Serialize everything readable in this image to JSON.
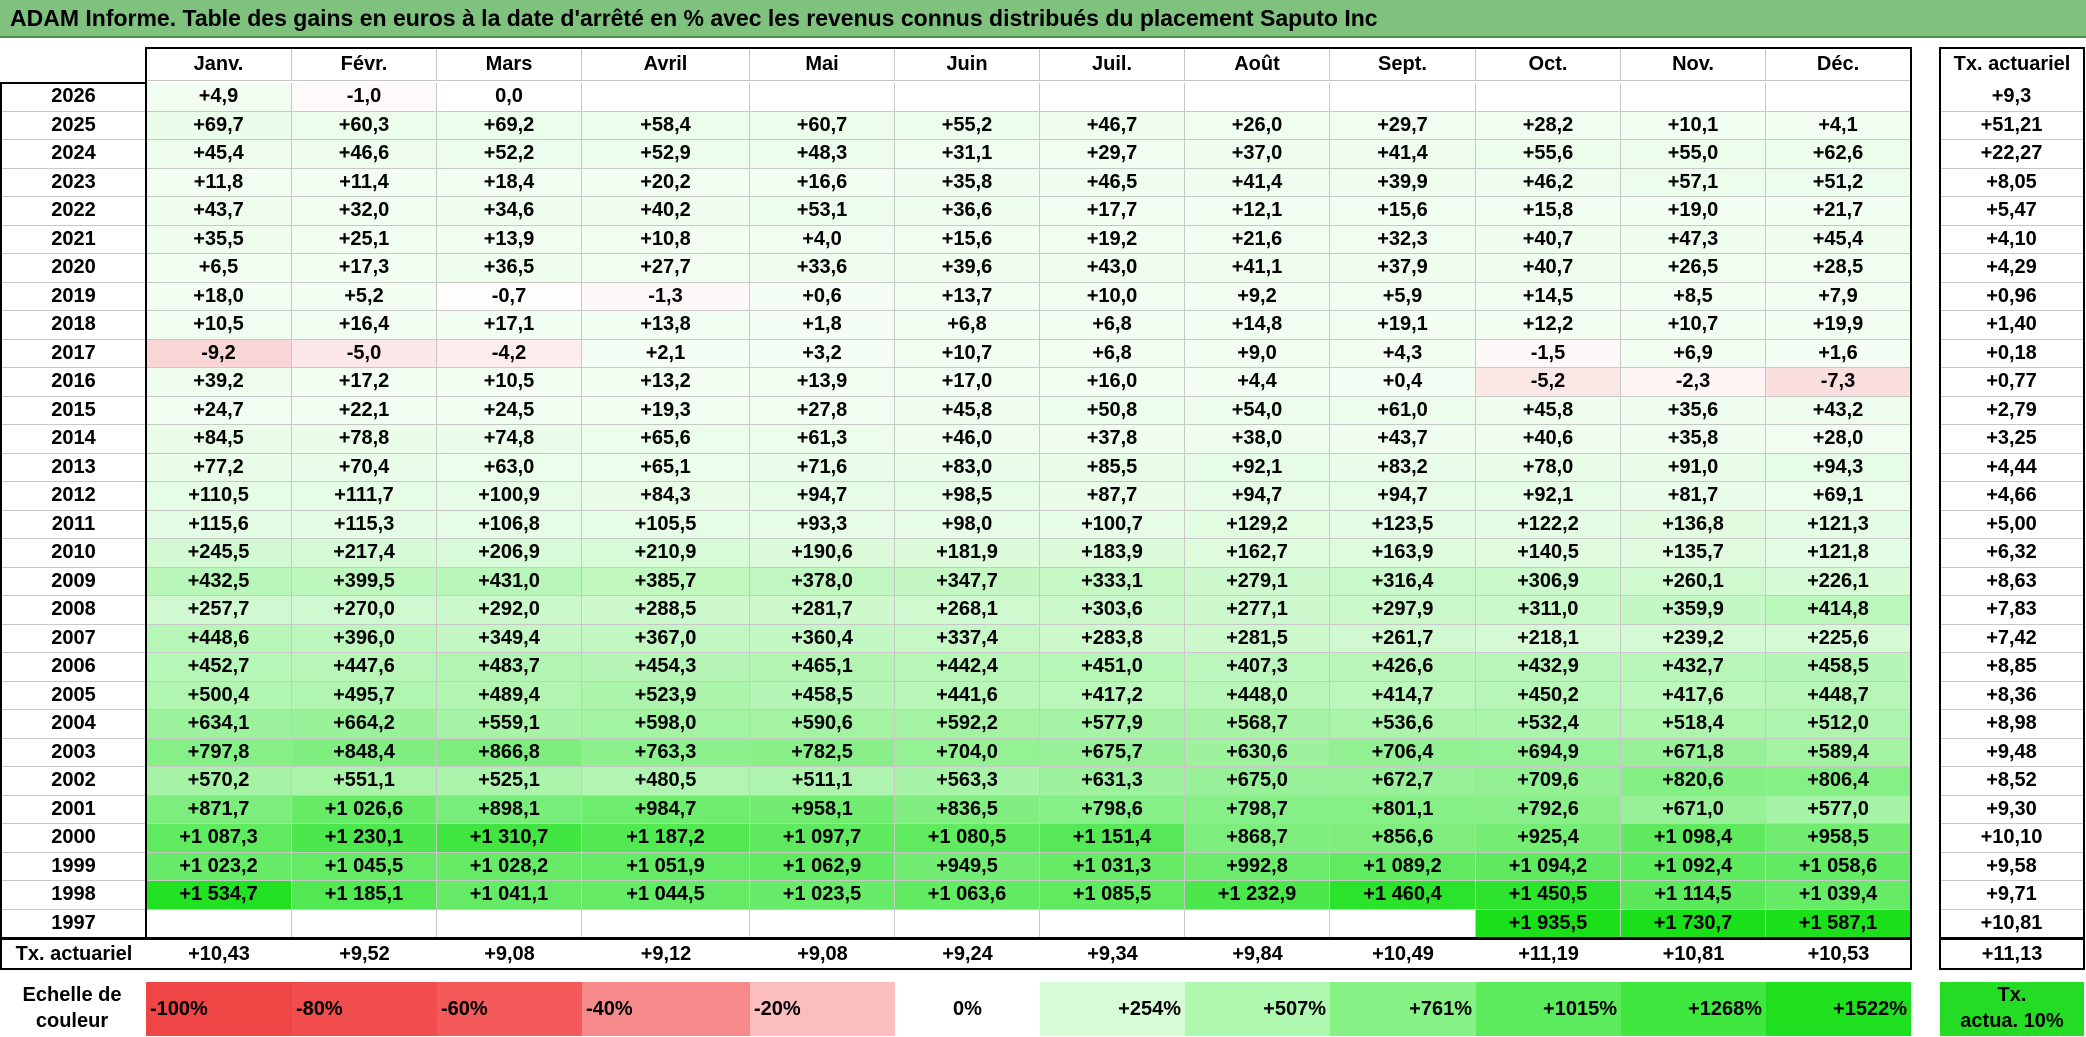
{
  "title": "ADAM Informe. Table des gains en euros à la date d'arrêté en % avec les revenus connus distribués du placement Saputo Inc",
  "chart_data": {
    "type": "table",
    "months": [
      "Janv.",
      "Févr.",
      "Mars",
      "Avril",
      "Mai",
      "Juin",
      "Juil.",
      "Août",
      "Sept.",
      "Oct.",
      "Nov.",
      "Déc."
    ],
    "rate_header": "Tx. actuariel",
    "rows": [
      {
        "year": "2026",
        "values": [
          "+4,9",
          "-1,0",
          "0,0",
          "",
          "",
          "",
          "",
          "",
          "",
          "",
          "",
          ""
        ],
        "rate": "+9,3"
      },
      {
        "year": "2025",
        "values": [
          "+69,7",
          "+60,3",
          "+69,2",
          "+58,4",
          "+60,7",
          "+55,2",
          "+46,7",
          "+26,0",
          "+29,7",
          "+28,2",
          "+10,1",
          "+4,1"
        ],
        "rate": "+51,21"
      },
      {
        "year": "2024",
        "values": [
          "+45,4",
          "+46,6",
          "+52,2",
          "+52,9",
          "+48,3",
          "+31,1",
          "+29,7",
          "+37,0",
          "+41,4",
          "+55,6",
          "+55,0",
          "+62,6"
        ],
        "rate": "+22,27"
      },
      {
        "year": "2023",
        "values": [
          "+11,8",
          "+11,4",
          "+18,4",
          "+20,2",
          "+16,6",
          "+35,8",
          "+46,5",
          "+41,4",
          "+39,9",
          "+46,2",
          "+57,1",
          "+51,2"
        ],
        "rate": "+8,05"
      },
      {
        "year": "2022",
        "values": [
          "+43,7",
          "+32,0",
          "+34,6",
          "+40,2",
          "+53,1",
          "+36,6",
          "+17,7",
          "+12,1",
          "+15,6",
          "+15,8",
          "+19,0",
          "+21,7"
        ],
        "rate": "+5,47"
      },
      {
        "year": "2021",
        "values": [
          "+35,5",
          "+25,1",
          "+13,9",
          "+10,8",
          "+4,0",
          "+15,6",
          "+19,2",
          "+21,6",
          "+32,3",
          "+40,7",
          "+47,3",
          "+45,4"
        ],
        "rate": "+4,10"
      },
      {
        "year": "2020",
        "values": [
          "+6,5",
          "+17,3",
          "+36,5",
          "+27,7",
          "+33,6",
          "+39,6",
          "+43,0",
          "+41,1",
          "+37,9",
          "+40,7",
          "+26,5",
          "+28,5"
        ],
        "rate": "+4,29"
      },
      {
        "year": "2019",
        "values": [
          "+18,0",
          "+5,2",
          "-0,7",
          "-1,3",
          "+0,6",
          "+13,7",
          "+10,0",
          "+9,2",
          "+5,9",
          "+14,5",
          "+8,5",
          "+7,9"
        ],
        "rate": "+0,96"
      },
      {
        "year": "2018",
        "values": [
          "+10,5",
          "+16,4",
          "+17,1",
          "+13,8",
          "+1,8",
          "+6,8",
          "+6,8",
          "+14,8",
          "+19,1",
          "+12,2",
          "+10,7",
          "+19,9"
        ],
        "rate": "+1,40"
      },
      {
        "year": "2017",
        "values": [
          "-9,2",
          "-5,0",
          "-4,2",
          "+2,1",
          "+3,2",
          "+10,7",
          "+6,8",
          "+9,0",
          "+4,3",
          "-1,5",
          "+6,9",
          "+1,6"
        ],
        "rate": "+0,18"
      },
      {
        "year": "2016",
        "values": [
          "+39,2",
          "+17,2",
          "+10,5",
          "+13,2",
          "+13,9",
          "+17,0",
          "+16,0",
          "+4,4",
          "+0,4",
          "-5,2",
          "-2,3",
          "-7,3"
        ],
        "rate": "+0,77"
      },
      {
        "year": "2015",
        "values": [
          "+24,7",
          "+22,1",
          "+24,5",
          "+19,3",
          "+27,8",
          "+45,8",
          "+50,8",
          "+54,0",
          "+61,0",
          "+45,8",
          "+35,6",
          "+43,2"
        ],
        "rate": "+2,79"
      },
      {
        "year": "2014",
        "values": [
          "+84,5",
          "+78,8",
          "+74,8",
          "+65,6",
          "+61,3",
          "+46,0",
          "+37,8",
          "+38,0",
          "+43,7",
          "+40,6",
          "+35,8",
          "+28,0"
        ],
        "rate": "+3,25"
      },
      {
        "year": "2013",
        "values": [
          "+77,2",
          "+70,4",
          "+63,0",
          "+65,1",
          "+71,6",
          "+83,0",
          "+85,5",
          "+92,1",
          "+83,2",
          "+78,0",
          "+91,0",
          "+94,3"
        ],
        "rate": "+4,44"
      },
      {
        "year": "2012",
        "values": [
          "+110,5",
          "+111,7",
          "+100,9",
          "+84,3",
          "+94,7",
          "+98,5",
          "+87,7",
          "+94,7",
          "+94,7",
          "+92,1",
          "+81,7",
          "+69,1"
        ],
        "rate": "+4,66"
      },
      {
        "year": "2011",
        "values": [
          "+115,6",
          "+115,3",
          "+106,8",
          "+105,5",
          "+93,3",
          "+98,0",
          "+100,7",
          "+129,2",
          "+123,5",
          "+122,2",
          "+136,8",
          "+121,3"
        ],
        "rate": "+5,00"
      },
      {
        "year": "2010",
        "values": [
          "+245,5",
          "+217,4",
          "+206,9",
          "+210,9",
          "+190,6",
          "+181,9",
          "+183,9",
          "+162,7",
          "+163,9",
          "+140,5",
          "+135,7",
          "+121,8"
        ],
        "rate": "+6,32"
      },
      {
        "year": "2009",
        "values": [
          "+432,5",
          "+399,5",
          "+431,0",
          "+385,7",
          "+378,0",
          "+347,7",
          "+333,1",
          "+279,1",
          "+316,4",
          "+306,9",
          "+260,1",
          "+226,1"
        ],
        "rate": "+8,63"
      },
      {
        "year": "2008",
        "values": [
          "+257,7",
          "+270,0",
          "+292,0",
          "+288,5",
          "+281,7",
          "+268,1",
          "+303,6",
          "+277,1",
          "+297,9",
          "+311,0",
          "+359,9",
          "+414,8"
        ],
        "rate": "+7,83"
      },
      {
        "year": "2007",
        "values": [
          "+448,6",
          "+396,0",
          "+349,4",
          "+367,0",
          "+360,4",
          "+337,4",
          "+283,8",
          "+281,5",
          "+261,7",
          "+218,1",
          "+239,2",
          "+225,6"
        ],
        "rate": "+7,42"
      },
      {
        "year": "2006",
        "values": [
          "+452,7",
          "+447,6",
          "+483,7",
          "+454,3",
          "+465,1",
          "+442,4",
          "+451,0",
          "+407,3",
          "+426,6",
          "+432,9",
          "+432,7",
          "+458,5"
        ],
        "rate": "+8,85"
      },
      {
        "year": "2005",
        "values": [
          "+500,4",
          "+495,7",
          "+489,4",
          "+523,9",
          "+458,5",
          "+441,6",
          "+417,2",
          "+448,0",
          "+414,7",
          "+450,2",
          "+417,6",
          "+448,7"
        ],
        "rate": "+8,36"
      },
      {
        "year": "2004",
        "values": [
          "+634,1",
          "+664,2",
          "+559,1",
          "+598,0",
          "+590,6",
          "+592,2",
          "+577,9",
          "+568,7",
          "+536,6",
          "+532,4",
          "+518,4",
          "+512,0"
        ],
        "rate": "+8,98"
      },
      {
        "year": "2003",
        "values": [
          "+797,8",
          "+848,4",
          "+866,8",
          "+763,3",
          "+782,5",
          "+704,0",
          "+675,7",
          "+630,6",
          "+706,4",
          "+694,9",
          "+671,8",
          "+589,4"
        ],
        "rate": "+9,48"
      },
      {
        "year": "2002",
        "values": [
          "+570,2",
          "+551,1",
          "+525,1",
          "+480,5",
          "+511,1",
          "+563,3",
          "+631,3",
          "+675,0",
          "+672,7",
          "+709,6",
          "+820,6",
          "+806,4"
        ],
        "rate": "+8,52"
      },
      {
        "year": "2001",
        "values": [
          "+871,7",
          "+1 026,6",
          "+898,1",
          "+984,7",
          "+958,1",
          "+836,5",
          "+798,6",
          "+798,7",
          "+801,1",
          "+792,6",
          "+671,0",
          "+577,0"
        ],
        "rate": "+9,30"
      },
      {
        "year": "2000",
        "values": [
          "+1 087,3",
          "+1 230,1",
          "+1 310,7",
          "+1 187,2",
          "+1 097,7",
          "+1 080,5",
          "+1 151,4",
          "+868,7",
          "+856,6",
          "+925,4",
          "+1 098,4",
          "+958,5"
        ],
        "rate": "+10,10"
      },
      {
        "year": "1999",
        "values": [
          "+1 023,2",
          "+1 045,5",
          "+1 028,2",
          "+1 051,9",
          "+1 062,9",
          "+949,5",
          "+1 031,3",
          "+992,8",
          "+1 089,2",
          "+1 094,2",
          "+1 092,4",
          "+1 058,6"
        ],
        "rate": "+9,58"
      },
      {
        "year": "1998",
        "values": [
          "+1 534,7",
          "+1 185,1",
          "+1 041,1",
          "+1 044,5",
          "+1 023,5",
          "+1 063,6",
          "+1 085,5",
          "+1 232,9",
          "+1 460,4",
          "+1 450,5",
          "+1 114,5",
          "+1 039,4"
        ],
        "rate": "+9,71"
      },
      {
        "year": "1997",
        "values": [
          "",
          "",
          "",
          "",
          "",
          "",
          "",
          "",
          "",
          "+1 935,5",
          "+1 730,7",
          "+1 587,1"
        ],
        "rate": "+10,81"
      }
    ],
    "footer": {
      "label": "Tx. actuariel",
      "values": [
        "+10,43",
        "+9,52",
        "+9,08",
        "+9,12",
        "+9,08",
        "+9,24",
        "+9,34",
        "+9,84",
        "+10,49",
        "+11,19",
        "+10,81",
        "+10,53"
      ],
      "rate": "+11,13"
    },
    "legend": {
      "label_line1": "Echelle de",
      "label_line2": "couleur",
      "items": [
        {
          "label": "-100%",
          "color": "#f04545",
          "value": -100
        },
        {
          "label": "-80%",
          "color": "#f24d4d",
          "value": -80
        },
        {
          "label": "-60%",
          "color": "#f45a5a",
          "value": -60
        },
        {
          "label": "-40%",
          "color": "#f68a8a",
          "value": -40
        },
        {
          "label": "-20%",
          "color": "#fbbdbd",
          "value": -20
        },
        {
          "label": "0%",
          "color": "#ffffff",
          "value": 0
        },
        {
          "label": "+254%",
          "color": "#d6fbd6",
          "value": 254
        },
        {
          "label": "+507%",
          "color": "#aff8af",
          "value": 507
        },
        {
          "label": "+761%",
          "color": "#86f286",
          "value": 761
        },
        {
          "label": "+1015%",
          "color": "#5ceb5c",
          "value": 1015
        },
        {
          "label": "+1268%",
          "color": "#3fe73f",
          "value": 1268
        },
        {
          "label": "+1522%",
          "color": "#1ee01e",
          "value": 1522
        }
      ],
      "rate_label_line1": "Tx.",
      "rate_label_line2": "actua. 10%",
      "rate_color": "#25dc25"
    },
    "colors": {
      "title_bar": "#7ec27e",
      "negative_cell": "#fde3e3",
      "zero_cell": "#ffffff"
    }
  }
}
